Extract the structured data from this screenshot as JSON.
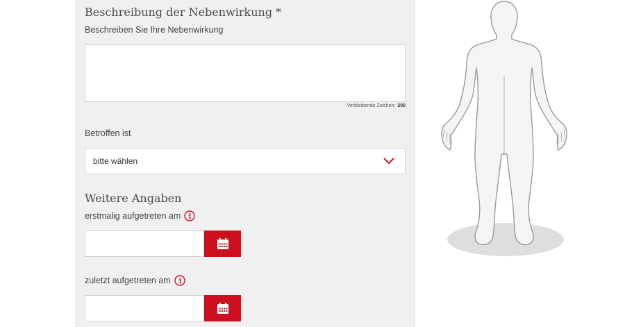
{
  "form": {
    "description_heading": "Beschreibung der Nebenwirkung *",
    "description_label": "Beschreiben Sie Ihre Nebenwirkung",
    "description_value": "",
    "remaining_label": "Verbleibende Zeichen:",
    "remaining_count": "200",
    "affected_label": "Betroffen ist",
    "affected_value": "bitte wählen",
    "more_heading": "Weitere Angaben",
    "first_label": "erstmalig aufgetreten am",
    "first_value": "",
    "last_label": "zuletzt aufgetreten am",
    "last_value": ""
  },
  "icons": {
    "info": "info-icon",
    "calendar": "calendar-icon",
    "dropdown": "chevron-down-icon",
    "body_figure": "human-body-figure"
  },
  "colors": {
    "accent": "#cc1020",
    "panel": "#f0f0f0",
    "figure_fill": "#f4f4f4",
    "figure_stroke": "#9a9a9a",
    "shadow": "#dedede"
  }
}
